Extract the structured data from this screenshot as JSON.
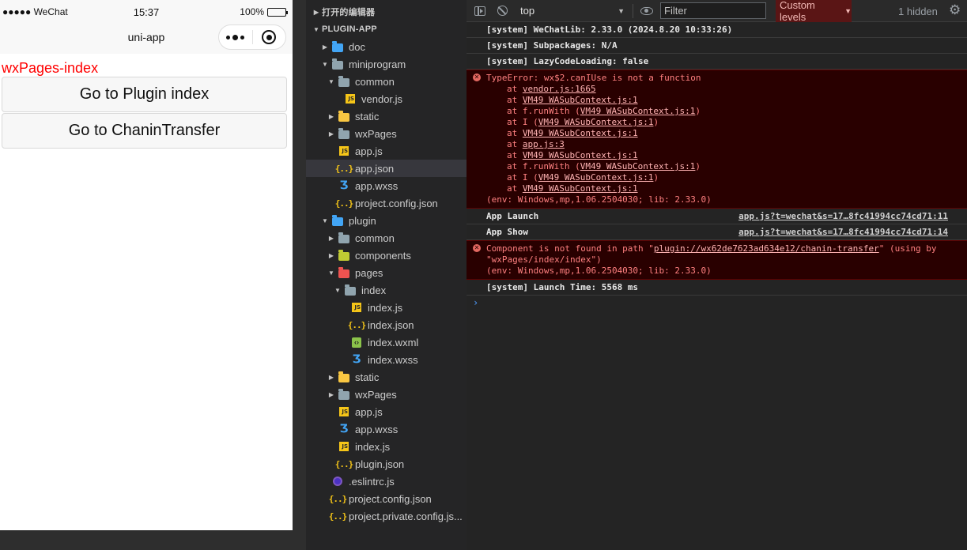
{
  "simulator": {
    "status_left": "●●●●● WeChat",
    "time": "15:37",
    "battery_text": "100%",
    "battery_level": 1.0,
    "nav_title": "uni-app",
    "page_heading": "wxPages-index",
    "buttons": [
      "Go to Plugin index",
      "Go to ChaninTransfer"
    ]
  },
  "explorer": {
    "section_editors": "打开的编辑器",
    "section_project": "PLUGIN-APP",
    "tree": [
      {
        "label": "doc",
        "depth": 1,
        "kind": "folder",
        "color": "blue",
        "expanded": false
      },
      {
        "label": "miniprogram",
        "depth": 1,
        "kind": "folder",
        "color": "gray",
        "expanded": true
      },
      {
        "label": "common",
        "depth": 2,
        "kind": "folder",
        "color": "gray",
        "expanded": true
      },
      {
        "label": "vendor.js",
        "depth": 3,
        "kind": "js"
      },
      {
        "label": "static",
        "depth": 2,
        "kind": "folder",
        "color": "yellow",
        "expanded": false
      },
      {
        "label": "wxPages",
        "depth": 2,
        "kind": "folder",
        "color": "gray",
        "expanded": false
      },
      {
        "label": "app.js",
        "depth": 2,
        "kind": "js"
      },
      {
        "label": "app.json",
        "depth": 2,
        "kind": "json",
        "selected": true
      },
      {
        "label": "app.wxss",
        "depth": 2,
        "kind": "css"
      },
      {
        "label": "project.config.json",
        "depth": 2,
        "kind": "json"
      },
      {
        "label": "plugin",
        "depth": 1,
        "kind": "folder",
        "color": "blue",
        "expanded": true
      },
      {
        "label": "common",
        "depth": 2,
        "kind": "folder",
        "color": "gray",
        "expanded": false
      },
      {
        "label": "components",
        "depth": 2,
        "kind": "folder",
        "color": "green",
        "expanded": false
      },
      {
        "label": "pages",
        "depth": 2,
        "kind": "folder",
        "color": "red",
        "expanded": true
      },
      {
        "label": "index",
        "depth": 3,
        "kind": "folder",
        "color": "gray",
        "expanded": true
      },
      {
        "label": "index.js",
        "depth": 4,
        "kind": "js"
      },
      {
        "label": "index.json",
        "depth": 4,
        "kind": "json"
      },
      {
        "label": "index.wxml",
        "depth": 4,
        "kind": "wxml"
      },
      {
        "label": "index.wxss",
        "depth": 4,
        "kind": "css"
      },
      {
        "label": "static",
        "depth": 2,
        "kind": "folder",
        "color": "yellow",
        "expanded": false
      },
      {
        "label": "wxPages",
        "depth": 2,
        "kind": "folder",
        "color": "gray",
        "expanded": false
      },
      {
        "label": "app.js",
        "depth": 2,
        "kind": "js"
      },
      {
        "label": "app.wxss",
        "depth": 2,
        "kind": "css"
      },
      {
        "label": "index.js",
        "depth": 2,
        "kind": "js"
      },
      {
        "label": "plugin.json",
        "depth": 2,
        "kind": "json"
      },
      {
        "label": ".eslintrc.js",
        "depth": 1,
        "kind": "eslint"
      },
      {
        "label": "project.config.json",
        "depth": 1,
        "kind": "json"
      },
      {
        "label": "project.private.config.js...",
        "depth": 1,
        "kind": "json"
      }
    ]
  },
  "console": {
    "toolbar": {
      "context": "top",
      "filter_placeholder": "Filter",
      "levels": "Custom levels",
      "hidden": "1 hidden"
    },
    "logs": [
      {
        "type": "info",
        "text": "[system] WeChatLib: 2.33.0 (2024.8.20 10:33:26)"
      },
      {
        "type": "info",
        "text": "[system] Subpackages: N/A"
      },
      {
        "type": "info",
        "text": "[system] LazyCodeLoading: false"
      },
      {
        "type": "error",
        "lines": [
          {
            "text": "TypeError: wx$2.canIUse is not a function"
          },
          {
            "pre": "at ",
            "link": "vendor.js:1665",
            "post": "",
            "indent": true
          },
          {
            "pre": "at ",
            "link": "VM49 WASubContext.js:1",
            "post": "",
            "indent": true
          },
          {
            "pre": "at f.runWith (",
            "link": "VM49 WASubContext.js:1",
            "post": ")",
            "indent": true
          },
          {
            "pre": "at I (",
            "link": "VM49 WASubContext.js:1",
            "post": ")",
            "indent": true
          },
          {
            "pre": "at ",
            "link": "VM49 WASubContext.js:1",
            "post": "",
            "indent": true
          },
          {
            "pre": "at ",
            "link": "app.js:3",
            "post": "",
            "indent": true
          },
          {
            "pre": "at ",
            "link": "VM49 WASubContext.js:1",
            "post": "",
            "indent": true
          },
          {
            "pre": "at f.runWith (",
            "link": "VM49 WASubContext.js:1",
            "post": ")",
            "indent": true
          },
          {
            "pre": "at I (",
            "link": "VM49 WASubContext.js:1",
            "post": ")",
            "indent": true
          },
          {
            "pre": "at ",
            "link": "VM49 WASubContext.js:1",
            "post": "",
            "indent": true
          },
          {
            "text": "(env: Windows,mp,1.06.2504030; lib: 2.33.0)"
          }
        ]
      },
      {
        "type": "info",
        "text": "App Launch",
        "source": "app.js?t=wechat&s=17…8fc41994cc74cd71:11"
      },
      {
        "type": "info",
        "text": "App Show",
        "source": "app.js?t=wechat&s=17…8fc41994cc74cd71:14"
      },
      {
        "type": "error",
        "lines": [
          {
            "pre": "Component is not found in path \"",
            "link": "plugin://wx62de7623ad634e12/chanin-transfer",
            "post": "\" (using by"
          },
          {
            "text": "\"wxPages/index/index\")"
          },
          {
            "text": "(env: Windows,mp,1.06.2504030; lib: 2.33.0)"
          }
        ]
      },
      {
        "type": "info",
        "text": "[system] Launch Time: 5568 ms"
      }
    ]
  }
}
